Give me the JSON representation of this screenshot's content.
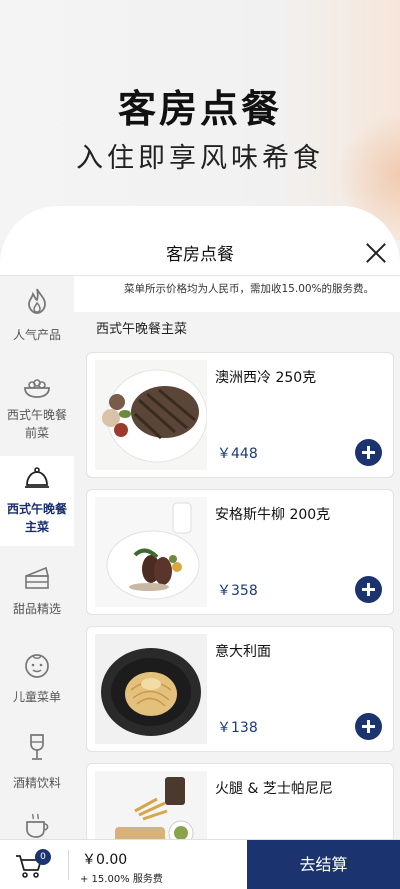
{
  "hero": {
    "title": "客房点餐",
    "subtitle": "入住即享风味希食"
  },
  "sheet": {
    "title": "客房点餐",
    "notice": "菜单所示价格均为人民币，需加收15.00%的服务费。"
  },
  "sidebar": {
    "items": [
      {
        "icon": "flame-icon",
        "label_line1": "人气产品",
        "label_line2": "",
        "active": false
      },
      {
        "icon": "salad-bowl-icon",
        "label_line1": "西式午晚餐",
        "label_line2": "前菜",
        "active": false
      },
      {
        "icon": "cloche-icon",
        "label_line1": "西式午晚餐",
        "label_line2": "主菜",
        "active": true
      },
      {
        "icon": "cake-slice-icon",
        "label_line1": "甜品精选",
        "label_line2": "",
        "active": false
      },
      {
        "icon": "child-face-icon",
        "label_line1": "儿童菜单",
        "label_line2": "",
        "active": false
      },
      {
        "icon": "wine-glass-icon",
        "label_line1": "酒精饮料",
        "label_line2": "",
        "active": false
      },
      {
        "icon": "coffee-cup-icon",
        "label_line1": "",
        "label_line2": "",
        "active": false
      }
    ]
  },
  "menu": {
    "section_title": "西式午晚餐主菜",
    "items": [
      {
        "name": "澳洲西冷 250克",
        "price": "￥448"
      },
      {
        "name": "安格斯牛柳 200克",
        "price": "￥358"
      },
      {
        "name": "意大利面",
        "price": "￥138"
      },
      {
        "name": "火腿 & 芝士帕尼尼",
        "price": ""
      }
    ]
  },
  "cart": {
    "count": "0",
    "total": "￥0.00",
    "fee_note": "+ 15.00% 服务费",
    "checkout_label": "去结算"
  },
  "colors": {
    "accent": "#1b3470",
    "price": "#1b3a7a",
    "sidebar_bg": "#f3f3f3"
  }
}
